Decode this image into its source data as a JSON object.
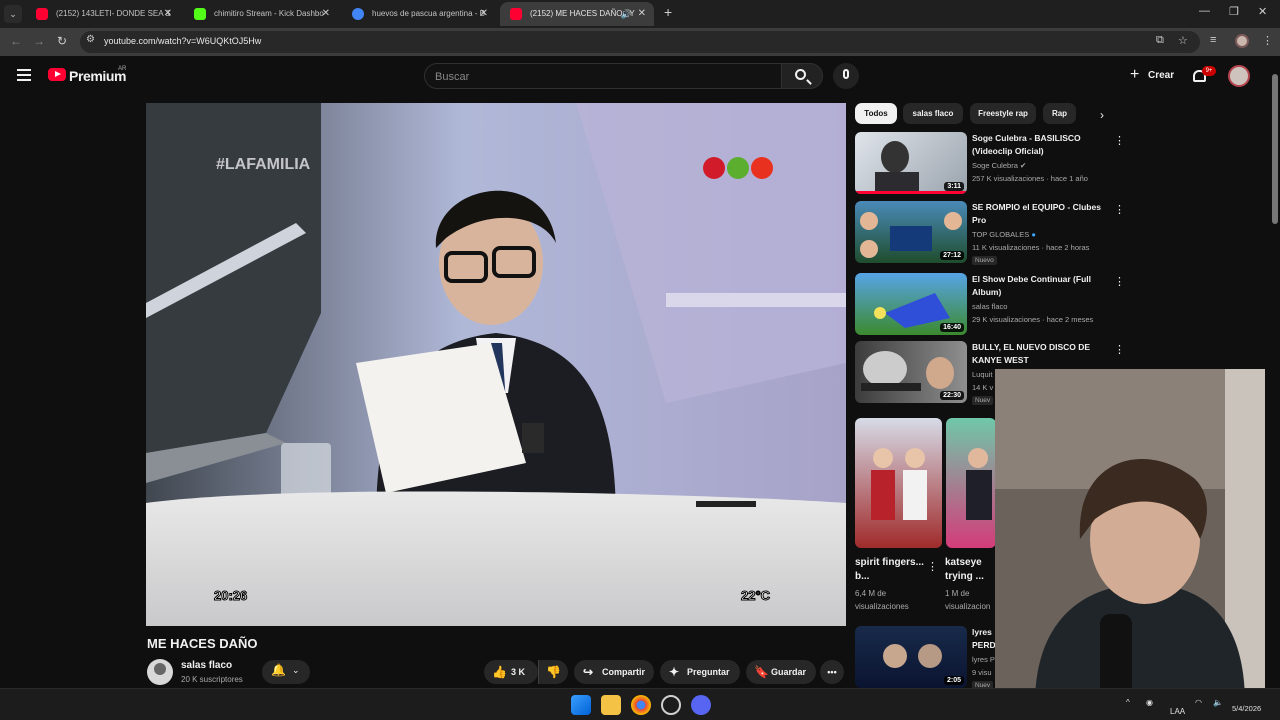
{
  "browser": {
    "tabs": [
      {
        "title": "(2152) 143LETI- DONDE SEA &",
        "favicon_color": "#ff0033",
        "active": false
      },
      {
        "title": "chimitiro Stream - Kick Dashbo",
        "favicon_color": "#53fc18",
        "active": false
      },
      {
        "title": "huevos de pascua argentina - B",
        "favicon_color": "#4285f4",
        "active": false
      },
      {
        "title": "(2152) ME HACES DAÑO - Y",
        "favicon_color": "#ff0033",
        "active": true
      }
    ],
    "url": "youtube.com/watch?v=W6UQKtOJ5Hw"
  },
  "masthead": {
    "brand": "Premium",
    "country": "AR",
    "search_placeholder": "Buscar",
    "create_label": "Crear",
    "notifications_badge": "9+"
  },
  "video": {
    "title": "ME HACES DAÑO",
    "overlay_watermark": "#LAFAMILIA",
    "overlay_time": "20:26",
    "overlay_temp": "22°C"
  },
  "channel": {
    "name": "salas flaco",
    "subscribers": "20 K suscriptores"
  },
  "actions": {
    "likes": "3 K",
    "share": "Compartir",
    "ask": "Preguntar",
    "save": "Guardar"
  },
  "chips": [
    "Todos",
    "salas flaco",
    "Freestyle rap",
    "Rap"
  ],
  "recommendations": [
    {
      "title": "Soge Culebra - BASILISCO (Videoclip Oficial)",
      "channel": "Soge Culebra",
      "verified": true,
      "meta": "257 K visualizaciones · hace 1 año",
      "duration": "3:11",
      "is_new": false,
      "new_label": ""
    },
    {
      "title": "SE ROMPIO el EQUIPO - Clubes Pro",
      "channel": "TOP GLOBALES",
      "verified": true,
      "meta": "11 K visualizaciones · hace 2 horas",
      "duration": "27:12",
      "is_new": true,
      "new_label": "Nuevo"
    },
    {
      "title": "El Show Debe Continuar (Full Album)",
      "channel": "salas flaco",
      "verified": false,
      "meta": "29 K visualizaciones · hace 2 meses",
      "duration": "16:40",
      "is_new": false,
      "new_label": ""
    },
    {
      "title": "BULLY, EL NUEVO DISCO DE KANYE WEST",
      "channel": "Luquit",
      "verified": false,
      "meta": "14 K v",
      "duration": "22:30",
      "is_new": true,
      "new_label": "Nuev"
    }
  ],
  "shorts": [
    {
      "title": "spirit fingers... b...",
      "views": "6,4 M de",
      "views2": "visualizaciones"
    },
    {
      "title": "katseye trying ...",
      "views": "1 M de",
      "views2": "visualizacion"
    }
  ],
  "rec_bottom": {
    "title": "lyres PERD",
    "channel": "lyres P",
    "meta": "9 visu",
    "duration": "2:05",
    "new_label": "Nuev"
  },
  "taskbar": {
    "language": "LAA",
    "date": "5/4/2026"
  },
  "colors": {
    "accent": "#ff0033",
    "background": "#0f0f0f",
    "surface": "#272727"
  }
}
